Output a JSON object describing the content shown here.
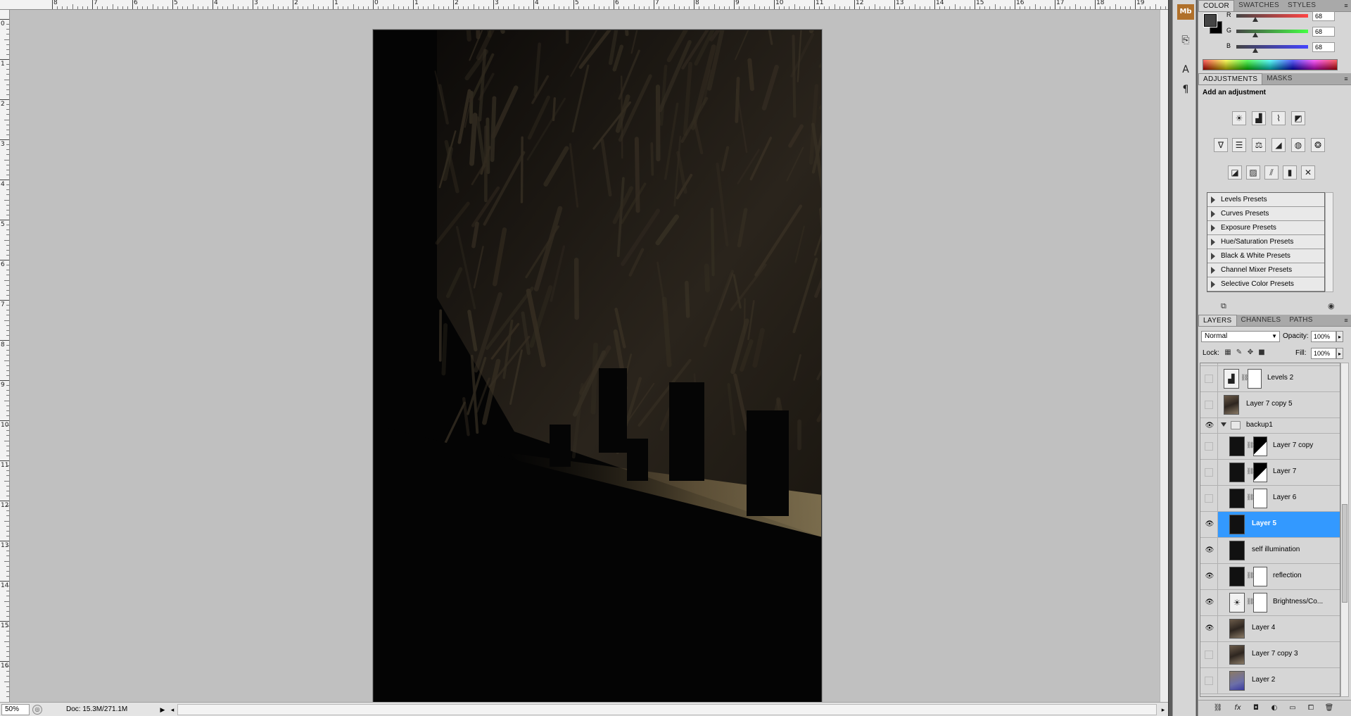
{
  "statusbar": {
    "zoom": "50%",
    "doc_info": "Doc: 15.3M/271.1M"
  },
  "rulers": {
    "top_labels": [
      "8",
      "7",
      "6",
      "5",
      "4",
      "3",
      "2",
      "1",
      "0",
      "1",
      "2",
      "3",
      "4",
      "5",
      "6",
      "7",
      "8",
      "9",
      "10",
      "11",
      "12",
      "13",
      "14",
      "15",
      "16",
      "17",
      "18",
      "19",
      "2"
    ],
    "left_labels": [
      "0",
      "1",
      "2",
      "3",
      "4",
      "5",
      "6",
      "7",
      "8",
      "9",
      "10",
      "11",
      "12",
      "13",
      "14",
      "15",
      "16"
    ]
  },
  "dock": {
    "icons": [
      "mini-bridge-icon",
      "history-icon",
      "character-icon",
      "paragraph-icon"
    ],
    "mini_bridge_label": "Mb"
  },
  "color_panel": {
    "tabs": [
      "COLOR",
      "SWATCHES",
      "STYLES"
    ],
    "active_tab": "COLOR",
    "foreground": "#444444",
    "background": "#000000",
    "channels": [
      {
        "label": "R",
        "value": "68",
        "level": 0.267
      },
      {
        "label": "G",
        "value": "68",
        "level": 0.267
      },
      {
        "label": "B",
        "value": "68",
        "level": 0.267
      }
    ]
  },
  "adjustments_panel": {
    "tabs": [
      "ADJUSTMENTS",
      "MASKS"
    ],
    "heading": "Add an adjustment",
    "icon_rows": [
      [
        "brightness-contrast-icon",
        "levels-icon",
        "curves-icon",
        "exposure-icon"
      ],
      [
        "vibrance-icon",
        "hue-saturation-icon",
        "color-balance-icon",
        "black-white-icon",
        "photo-filter-icon",
        "channel-mixer-icon"
      ],
      [
        "invert-icon",
        "posterize-icon",
        "threshold-icon",
        "gradient-map-icon",
        "selective-color-icon"
      ]
    ],
    "presets": [
      "Levels Presets",
      "Curves Presets",
      "Exposure Presets",
      "Hue/Saturation Presets",
      "Black & White Presets",
      "Channel Mixer Presets",
      "Selective Color Presets"
    ]
  },
  "layers_panel": {
    "tabs": [
      "LAYERS",
      "CHANNELS",
      "PATHS"
    ],
    "active_tab": "LAYERS",
    "blend_mode": "Normal",
    "opacity_label": "Opacity:",
    "opacity": "100%",
    "lock_label": "Lock:",
    "fill_label": "Fill:",
    "fill": "100%",
    "layers": [
      {
        "name": "Levels 2",
        "kind": "adjustment",
        "visible": false,
        "mask": "white",
        "indent": false
      },
      {
        "name": "Layer 7 copy 5",
        "kind": "photo",
        "visible": false,
        "mask": "",
        "indent": false
      },
      {
        "name": "backup1",
        "kind": "group",
        "visible": true,
        "mask": "",
        "indent": false
      },
      {
        "name": "Layer 7 copy",
        "kind": "dark",
        "visible": false,
        "mask": "dark",
        "indent": true
      },
      {
        "name": "Layer 7",
        "kind": "dark",
        "visible": false,
        "mask": "dark",
        "indent": true
      },
      {
        "name": "Layer 6",
        "kind": "dark",
        "visible": false,
        "mask": "white",
        "indent": true
      },
      {
        "name": "Layer 5",
        "kind": "dark",
        "visible": true,
        "mask": "",
        "indent": true,
        "selected": true
      },
      {
        "name": "self illumination",
        "kind": "dark",
        "visible": true,
        "mask": "",
        "indent": true
      },
      {
        "name": "reflection",
        "kind": "dark",
        "visible": true,
        "mask": "white",
        "indent": true
      },
      {
        "name": "Brightness/Co...",
        "kind": "adjustment",
        "visible": true,
        "mask": "white",
        "indent": true
      },
      {
        "name": "Layer 4",
        "kind": "photo",
        "visible": true,
        "mask": "",
        "indent": true
      },
      {
        "name": "Layer 7 copy 3",
        "kind": "photo",
        "visible": false,
        "mask": "",
        "indent": true
      },
      {
        "name": "Layer 2",
        "kind": "photo-blue",
        "visible": false,
        "mask": "",
        "indent": true
      }
    ],
    "footer_icons": [
      "link-layers-icon",
      "fx-icon",
      "add-mask-icon",
      "new-adjustment-icon",
      "new-group-icon",
      "new-layer-icon",
      "delete-layer-icon"
    ]
  }
}
